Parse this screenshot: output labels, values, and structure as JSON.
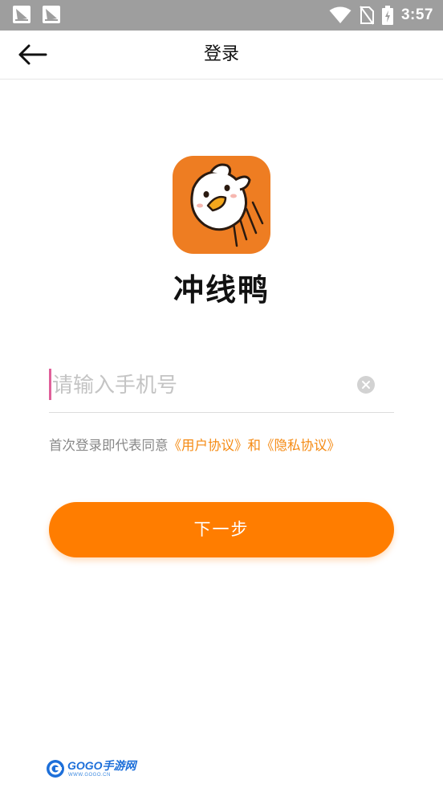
{
  "status_bar": {
    "time": "3:57",
    "icons": [
      "notification-icon",
      "notification-icon",
      "wifi-icon",
      "no-sim-icon",
      "battery-charging-icon"
    ]
  },
  "header": {
    "title": "登录",
    "back_icon": "arrow-left-icon"
  },
  "app": {
    "name": "冲线鸭",
    "logo": "duck-logo",
    "accent": "#ee7d22"
  },
  "login": {
    "phone_placeholder": "请输入手机号",
    "phone_value": "",
    "clear_icon": "clear-icon",
    "agreement_prefix": "首次登录即代表同意",
    "user_agreement": "《用户协议》",
    "and_text": "和",
    "privacy_agreement": "《隐私协议》",
    "next_label": "下一步",
    "button_color": "#ff7d00",
    "link_color": "#f58a12"
  },
  "watermark": {
    "brand": "GOGO手游网",
    "url": "WWW.GOGO.CN"
  }
}
